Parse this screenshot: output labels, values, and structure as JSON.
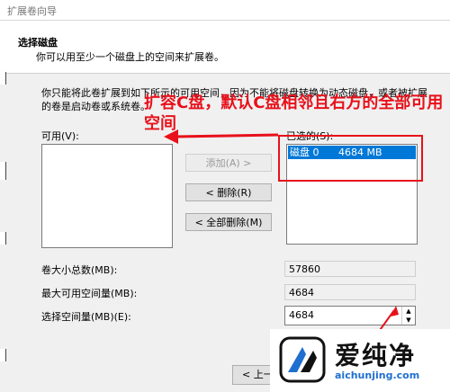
{
  "window": {
    "title": "扩展卷向导"
  },
  "header": {
    "title": "选择磁盘",
    "subtitle": "你可以用至少一个磁盘上的空间来扩展卷。"
  },
  "description": "你只能将此卷扩展到如下所示的可用空间，因为不能将磁盘转换为动态磁盘，或者被扩展的卷是启动卷或系统卷。",
  "available": {
    "label": "可用(V):",
    "items": []
  },
  "selected": {
    "label": "已选的(S):",
    "items": [
      {
        "disk": "磁盘 0",
        "size": "4684 MB"
      }
    ]
  },
  "buttons": {
    "add": "添加(A) >",
    "remove": "< 删除(R)",
    "remove_all": "< 全部删除(M)",
    "back": "< 上一"
  },
  "fields": {
    "total_label": "卷大小总数(MB):",
    "total_value": "57860",
    "max_label": "最大可用空间量(MB):",
    "max_value": "4684",
    "select_label": "选择空间量(MB)(E):",
    "select_value": "4684"
  },
  "annotation": {
    "line1": "扩容C盘，默认C盘相邻且右方的全部可用",
    "line2": "空间",
    "color": "#e8101a"
  },
  "watermark": {
    "name": "爱纯净",
    "url": "aichunjing.com"
  }
}
